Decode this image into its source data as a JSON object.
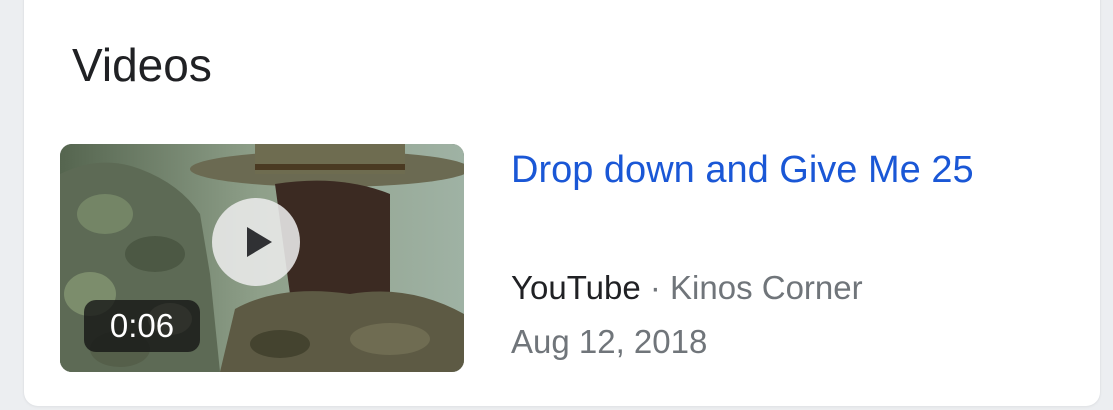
{
  "section": {
    "title": "Videos"
  },
  "video": {
    "title": "Drop down and Give Me 25",
    "duration": "0:06",
    "source": "YouTube",
    "separator": " · ",
    "channel": "Kinos Corner",
    "date": "Aug 12, 2018",
    "thumbnail_icon": "play-icon"
  },
  "colors": {
    "link": "#1a57d6",
    "primary_text": "#202124",
    "secondary_text": "#70757a",
    "card_bg": "#ffffff",
    "page_bg": "#eceef1"
  }
}
